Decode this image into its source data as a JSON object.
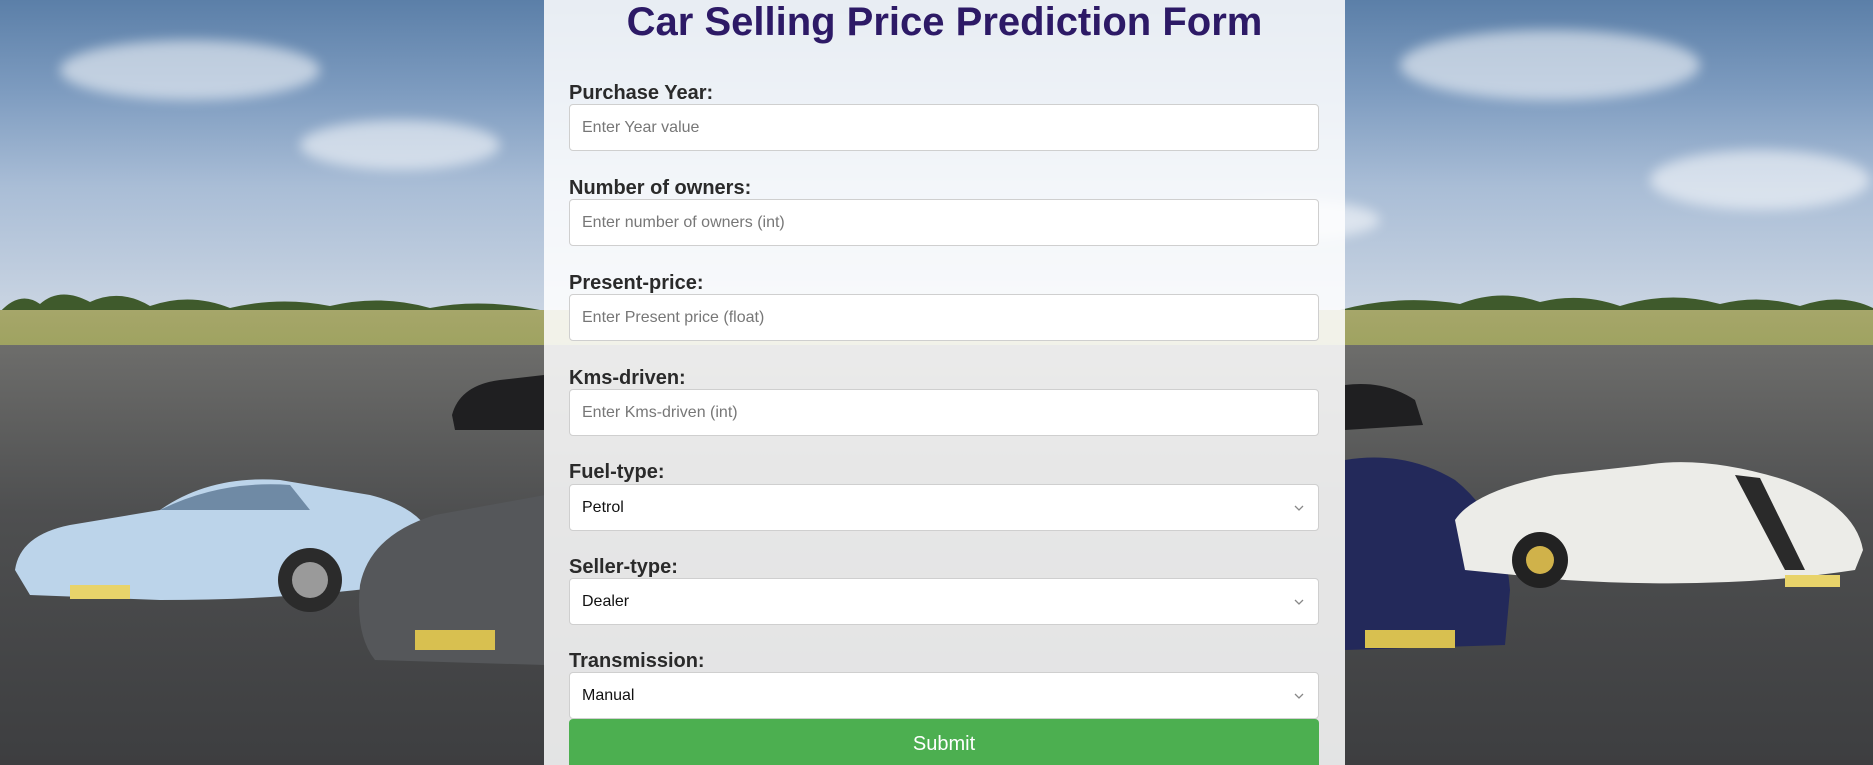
{
  "page": {
    "title": "Car Selling Price Prediction Form"
  },
  "colors": {
    "title": "#2d1a66",
    "submit_bg": "#4caf50",
    "panel_bg": "rgba(255,255,255,0.86)"
  },
  "form": {
    "year": {
      "label": "Purchase Year:",
      "placeholder": "Enter Year value",
      "value": ""
    },
    "owners": {
      "label": "Number of owners:",
      "placeholder": "Enter number of owners (int)",
      "value": ""
    },
    "present_price": {
      "label": "Present-price:",
      "placeholder": "Enter Present price (float)",
      "value": ""
    },
    "kms_driven": {
      "label": "Kms-driven:",
      "placeholder": "Enter Kms-driven (int)",
      "value": ""
    },
    "fuel_type": {
      "label": "Fuel-type:",
      "selected": "Petrol",
      "icon": "chevron-down-icon"
    },
    "seller_type": {
      "label": "Seller-type:",
      "selected": "Dealer",
      "icon": "chevron-down-icon"
    },
    "transmission": {
      "label": "Transmission:",
      "selected": "Manual",
      "icon": "chevron-down-icon"
    },
    "submit_label": "Submit"
  }
}
